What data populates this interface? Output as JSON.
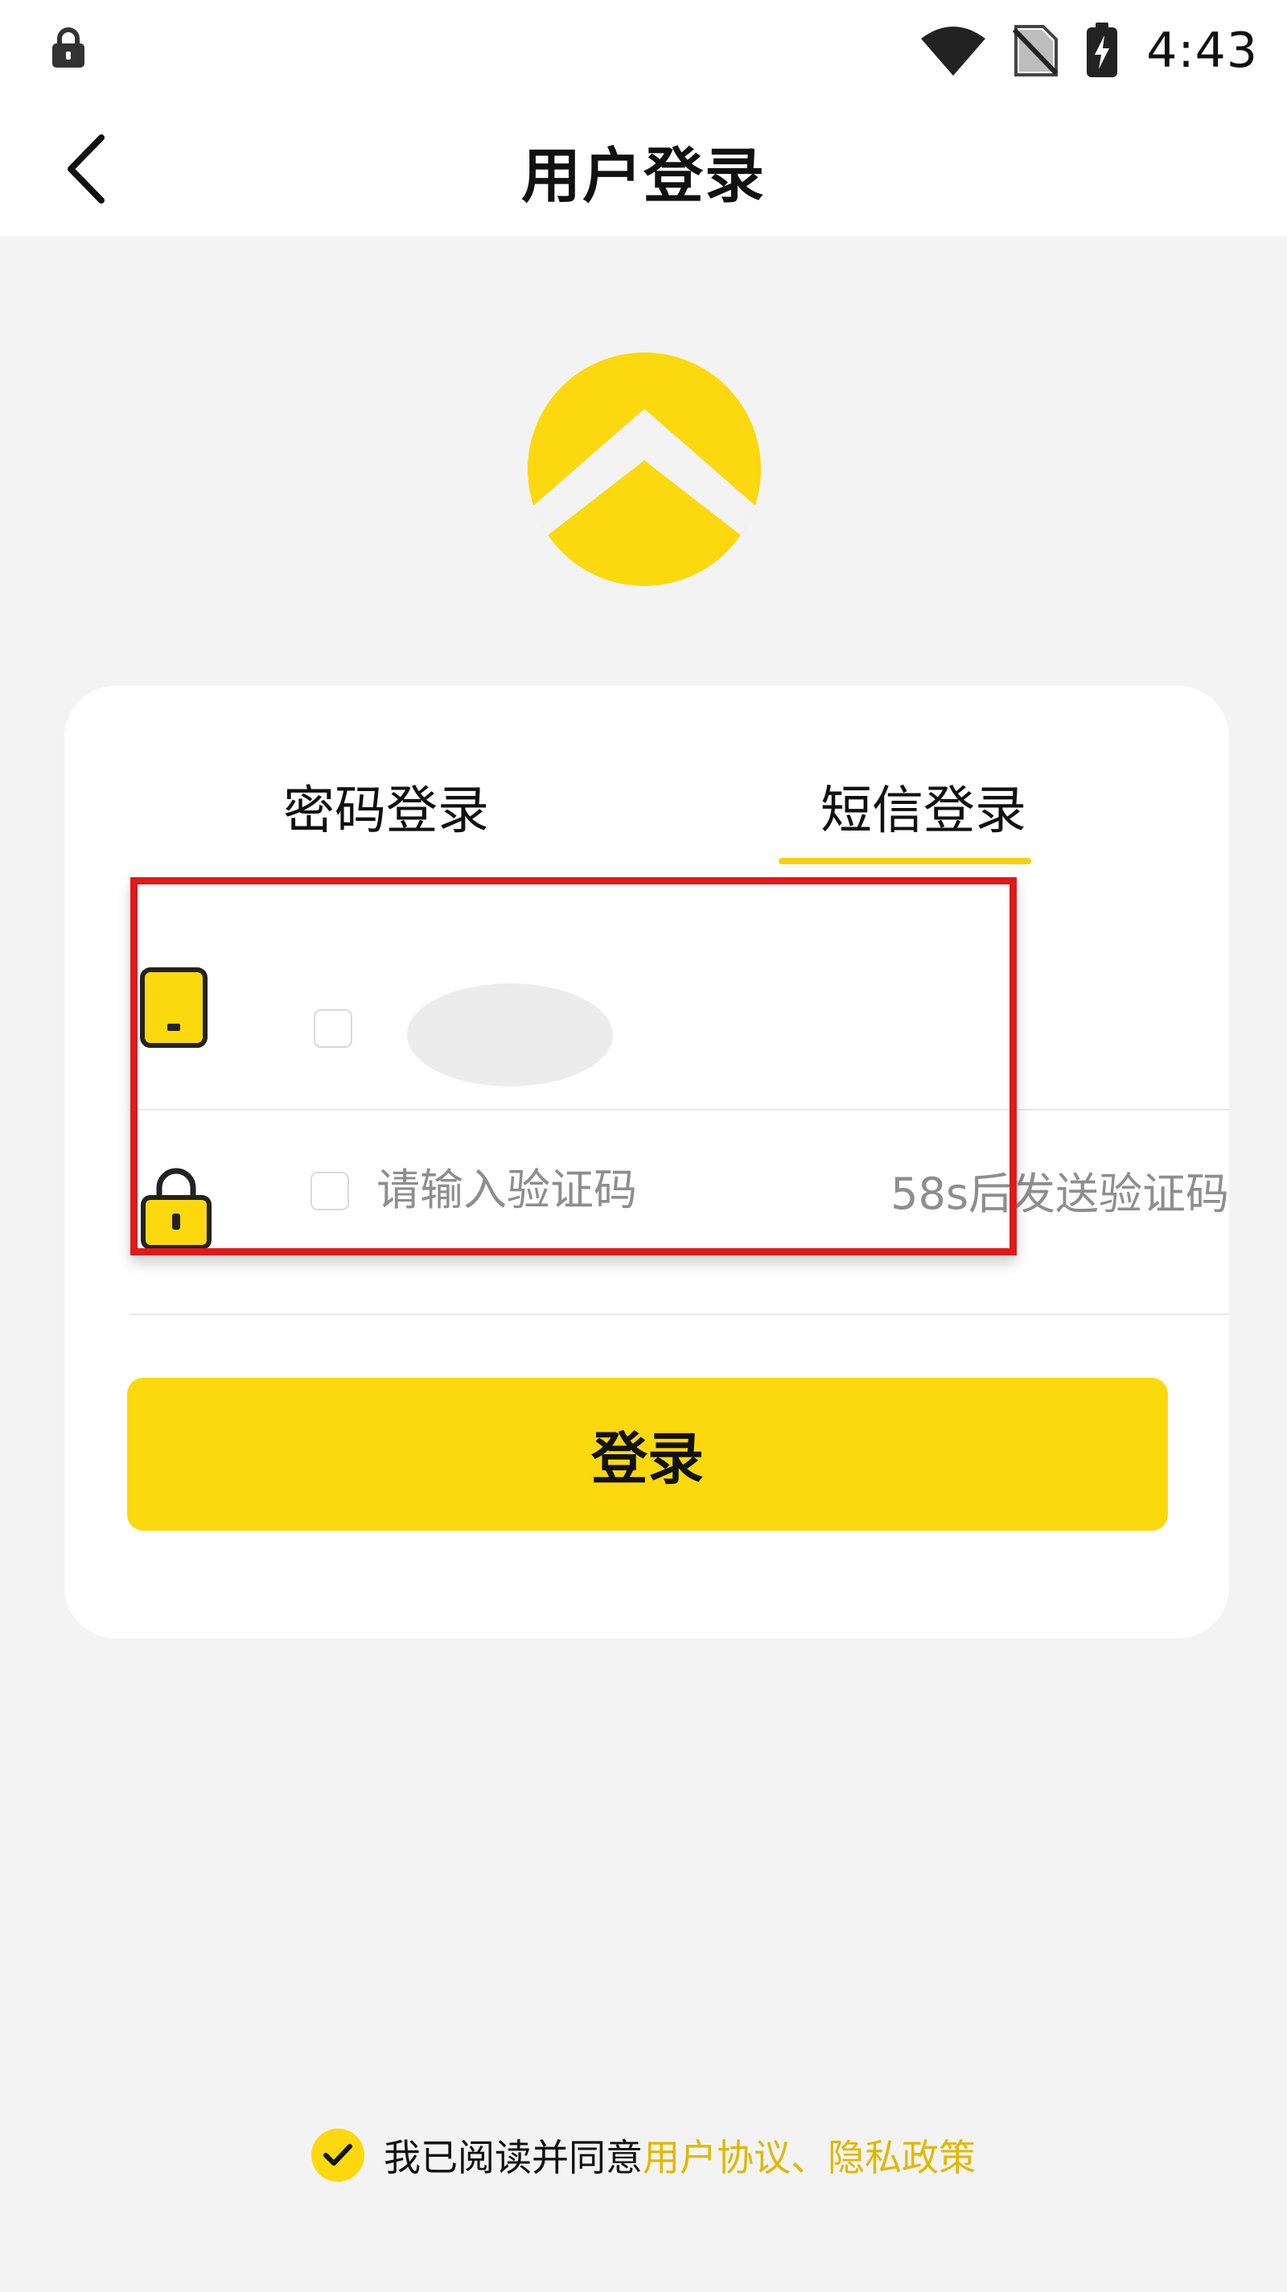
{
  "status_bar": {
    "time": "4:43"
  },
  "nav": {
    "title": "用户登录"
  },
  "tabs": [
    {
      "label": "密码登录",
      "active": false
    },
    {
      "label": "短信登录",
      "active": true
    }
  ],
  "form": {
    "code_placeholder": "请输入验证码",
    "code_value": "",
    "send_code_label": "58s后发送验证码"
  },
  "login_button": {
    "label": "登录"
  },
  "agreement": {
    "checked": true,
    "text": "我已阅读并同意",
    "user_agreement": "用户协议",
    "separator": "、",
    "privacy_policy": "隐私政策"
  },
  "colors": {
    "accent": "#fcd80e",
    "highlight_border": "#de1a1a",
    "link": "#e0b800",
    "placeholder": "#8e8e8e"
  }
}
